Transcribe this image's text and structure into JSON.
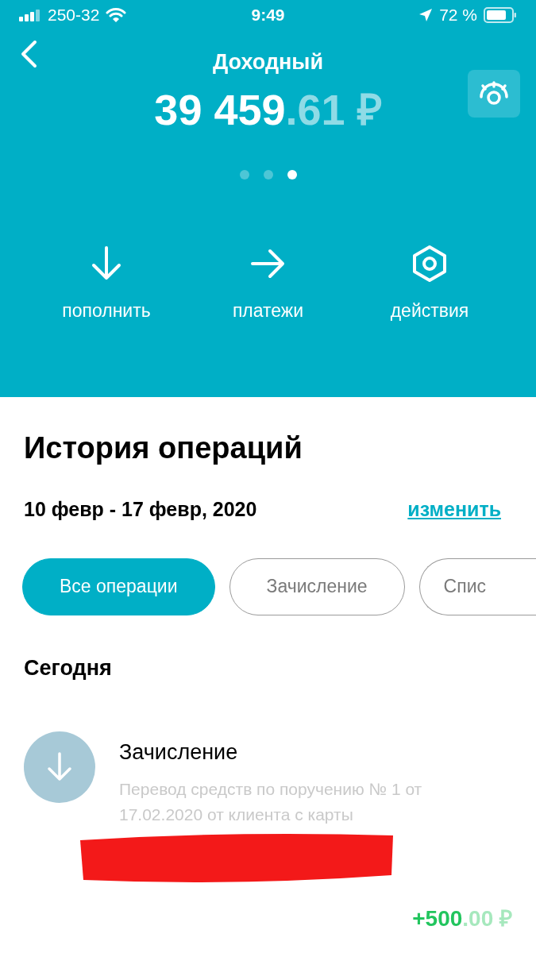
{
  "status_bar": {
    "carrier": "250-32",
    "time": "9:49",
    "battery": "72 %"
  },
  "header": {
    "title": "Доходный",
    "balance": {
      "main": "39 459",
      "fraction": ".61",
      "currency": "₽"
    },
    "pages": [
      {
        "selected": false
      },
      {
        "selected": false
      },
      {
        "selected": true
      }
    ],
    "actions": [
      {
        "kind": "down",
        "label": "пополнить"
      },
      {
        "kind": "right",
        "label": "платежи"
      },
      {
        "kind": "hex",
        "label": "действия"
      }
    ]
  },
  "history": {
    "title": "История операций",
    "period": "10 февр - 17 февр, 2020",
    "change_link": "изменить",
    "filters": [
      {
        "label": "Все операции",
        "selected": true
      },
      {
        "label": "Зачисление",
        "selected": false
      },
      {
        "label": "Спис",
        "selected": false
      }
    ],
    "group": "Сегодня",
    "operations": [
      {
        "title": "Зачисление",
        "description": "Перевод средств по поручению № 1 от 17.02.2020 от клиента с карты",
        "amount": {
          "main": "+500",
          "fraction": ".00",
          "currency": "₽"
        }
      }
    ]
  }
}
